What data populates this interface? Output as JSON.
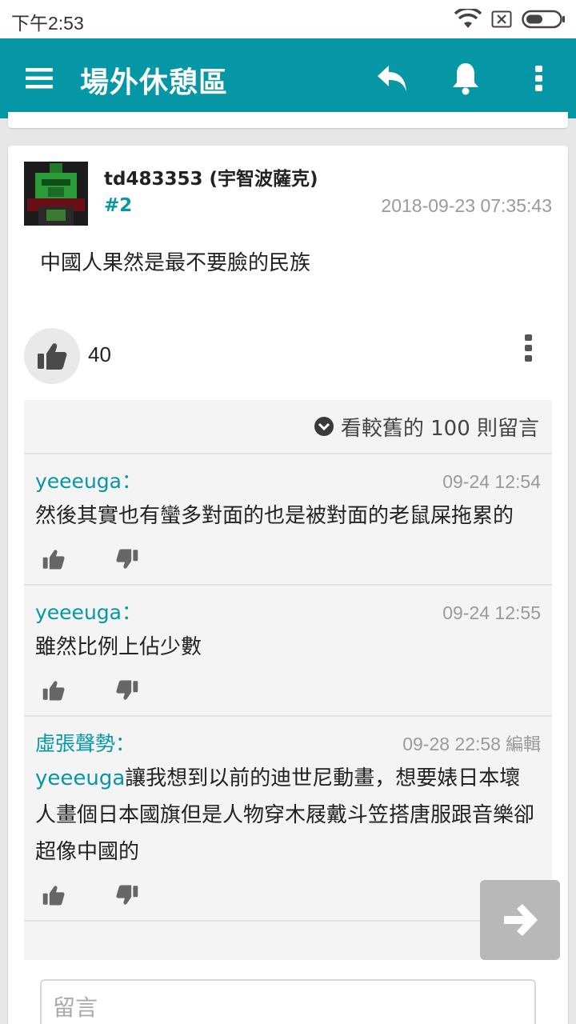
{
  "status": {
    "time": "下午2:53"
  },
  "toolbar": {
    "title": "場外休憩區"
  },
  "post": {
    "author": "td483353 (宇智波薩克)",
    "floor": "#2",
    "time": "2018-09-23 07:35:43",
    "body": "中國人果然是最不要臉的民族",
    "likes": "40"
  },
  "comments": {
    "older_label": "看較舊的 100 則留言",
    "items": [
      {
        "user": "yeeeuga：",
        "time": "09-24 12:54",
        "text": "然後其實也有蠻多對面的也是被對面的老鼠屎拖累的"
      },
      {
        "user": "yeeeuga：",
        "time": "09-24 12:55",
        "text": "雖然比例上佔少數"
      },
      {
        "user": "虛張聲勢：",
        "time": "09-28 22:58",
        "edit": "編輯",
        "mention": "yeeeuga",
        "text": "讓我想到以前的迪世尼動畫，想要婊日本壞人畫個日本國旗但是人物穿木屐戴斗笠搭唐服跟音樂卻超像中國的"
      }
    ]
  },
  "input": {
    "placeholder": "留言"
  },
  "colors": {
    "accent": "#0597a6",
    "toolbar_bg": "#0597a6"
  },
  "icons": [
    "menu-icon",
    "reply-icon",
    "bell-icon",
    "more-vert-icon",
    "thumb-up-icon",
    "thumb-down-icon",
    "chevron-down-circle-icon",
    "arrow-right-icon",
    "wifi-icon",
    "sim-icon",
    "battery-icon"
  ]
}
